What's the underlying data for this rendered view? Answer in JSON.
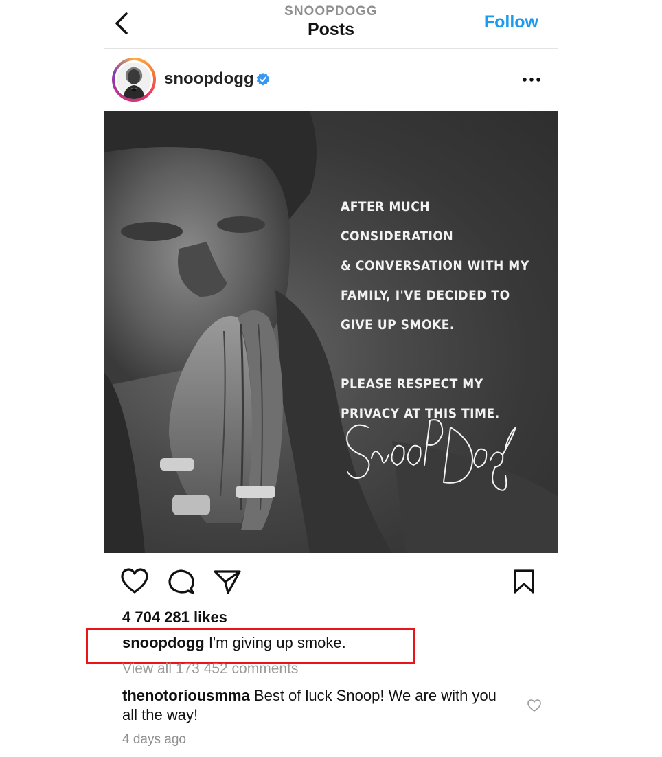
{
  "header": {
    "account_label": "SNOOPDOGG",
    "title": "Posts",
    "follow_label": "Follow"
  },
  "post": {
    "username": "snoopdogg",
    "verified": true,
    "image_text": {
      "lines_block1": [
        "AFTER MUCH CONSIDERATION",
        "& CONVERSATION WITH MY",
        "FAMILY, I'VE DECIDED TO",
        "GIVE UP SMOKE."
      ],
      "lines_block2": [
        "PLEASE RESPECT MY",
        "PRIVACY AT THIS TIME."
      ],
      "signature": "Snoop Dogg"
    },
    "likes": "4 704 281 likes",
    "caption_user": "snoopdogg",
    "caption_text": " I'm giving up smoke.",
    "view_comments": "View all 173 452 comments",
    "top_comment": {
      "user": "thenotoriousmma",
      "text": " Best of luck Snoop! We are with you all the way!"
    },
    "timestamp": "4 days ago"
  },
  "icons": {
    "back": "chevron-left-icon",
    "verified": "verified-badge-icon",
    "more": "more-horizontal-icon",
    "like": "heart-icon",
    "comment": "comment-bubble-icon",
    "share": "paper-plane-icon",
    "save": "bookmark-icon",
    "comment_like": "small-heart-icon"
  },
  "colors": {
    "accent": "#1a9bf0",
    "highlight_border": "#e8151b",
    "muted_text": "#8e8e8e"
  }
}
